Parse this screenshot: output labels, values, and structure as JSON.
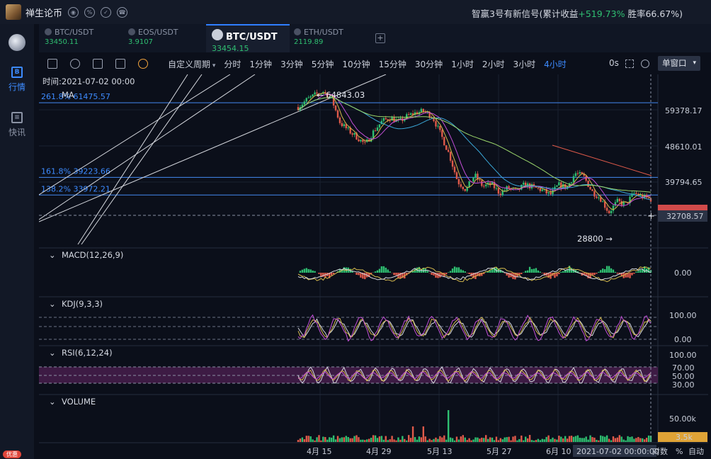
{
  "app": {
    "name": "禅生论币",
    "top_icons": [
      "eye-icon",
      "discount-icon",
      "compass-icon",
      "phone-icon"
    ],
    "signal_prefix": "智赢3号有新信号(累计收益",
    "signal_gain": "+519.73%",
    "signal_suffix": "胜率66.67%)"
  },
  "sidebar": {
    "items": [
      {
        "label": "行情",
        "icon": "quote-icon",
        "active": true
      },
      {
        "label": "快讯",
        "icon": "news-icon",
        "active": false
      }
    ],
    "promo": "优惠"
  },
  "tabs": [
    {
      "name": "BTC/USDT",
      "price": "33450.11",
      "color": "#2fbf71",
      "active": false
    },
    {
      "name": "EOS/USDT",
      "price": "3.9107",
      "color": "#2fbf71",
      "active": false
    },
    {
      "name": "BTC/USDT",
      "price": "33454.15",
      "color": "#2fbf71",
      "active": true
    },
    {
      "name": "ETH/USDT",
      "price": "2119.89",
      "color": "#2fbf71",
      "active": false
    }
  ],
  "add_tab": "+",
  "toolbar": {
    "tools": [
      "line-tool-icon",
      "indicator-icon",
      "draw-icon",
      "template-icon",
      "clock-icon"
    ],
    "custom_period": "自定义周期",
    "periods": [
      "分时",
      "1分钟",
      "3分钟",
      "5分钟",
      "10分钟",
      "15分钟",
      "30分钟",
      "1小时",
      "2小时",
      "3小时",
      "4小时"
    ],
    "active_period": "4小时",
    "countdown": "0s",
    "window_mode": "单窗口"
  },
  "chart_data": {
    "type": "candlestick",
    "symbol": "BTC/USDT",
    "interval": "4小时",
    "time_label": "时间:2021-07-02 00:00",
    "current_price": 32708.57,
    "current_price_label": "32708.57",
    "high_marker": "64843.03",
    "low_marker": "28800",
    "y_ticks": [
      "59378.17",
      "48610.01",
      "39794.65"
    ],
    "fib_levels": [
      {
        "label": "261.8% 61475.57",
        "value": 61475.57
      },
      {
        "label": "161.8% 39223.66",
        "value": 39223.66
      },
      {
        "label": "138.2% 33972.21",
        "value": 33972.21
      }
    ],
    "x_ticks": [
      "4月 15",
      "4月 29",
      "5月 13",
      "5月 27",
      "6月 10"
    ],
    "crosshair_time": "2021-07-02 00:00:00",
    "price_path": [
      60200,
      62300,
      63800,
      64843,
      62500,
      55500,
      53200,
      51200,
      49000,
      53000,
      56000,
      57000,
      55800,
      57500,
      58500,
      59000,
      57300,
      52000,
      46000,
      38000,
      35500,
      40000,
      36500,
      37300,
      34500,
      36200,
      35000,
      37200,
      36200,
      35500,
      34000,
      37000,
      36200,
      40500,
      39500,
      35000,
      33000,
      28800,
      32000,
      31200,
      34500,
      33400,
      32700
    ],
    "indicators": [
      {
        "name": "MA",
        "lines": [
          "#d5b94c",
          "#c44fd8",
          "#3aa6d6",
          "#9bd66b"
        ]
      },
      {
        "name": "MACD(12,26,9)",
        "ticks": [
          "0.00"
        ]
      },
      {
        "name": "KDJ(9,3,3)",
        "ticks": [
          "100.00",
          "0.00"
        ]
      },
      {
        "name": "RSI(6,12,24)",
        "ticks": [
          "100.00",
          "70.00",
          "50.00",
          "30.00"
        ]
      },
      {
        "name": "VOLUME",
        "ticks": [
          "50.00k"
        ],
        "current": "3.5k"
      }
    ],
    "footer": {
      "compare": "对数",
      "percent": "%",
      "auto": "自动"
    }
  }
}
